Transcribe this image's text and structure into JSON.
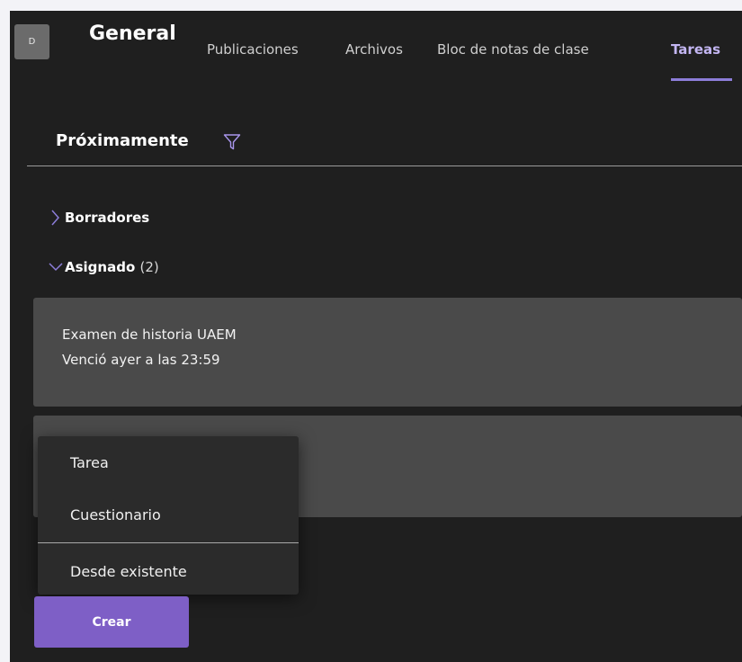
{
  "header": {
    "avatar_initial": "D",
    "team_name": "General",
    "tabs": [
      {
        "label": "Publicaciones"
      },
      {
        "label": "Archivos"
      },
      {
        "label": "Bloc de notas de clase"
      },
      {
        "label": "Tareas",
        "active": true
      }
    ]
  },
  "section": {
    "title": "Próximamente",
    "filter_icon": "filter-icon"
  },
  "groups": [
    {
      "label": "Borradores",
      "expanded": false
    },
    {
      "label": "Asignado",
      "count": "(2)",
      "expanded": true
    }
  ],
  "assignments": [
    {
      "title": "Examen de historia UAEM",
      "due": "Venció ayer a las 23:59"
    }
  ],
  "create_menu": {
    "items": [
      {
        "label": "Tarea"
      },
      {
        "label": "Cuestionario"
      },
      {
        "label": "Desde existente"
      }
    ]
  },
  "create_button": {
    "label": "Crear"
  },
  "colors": {
    "accent": "#8c7dd9",
    "button": "#7e5fc6",
    "background": "#1f1f1f",
    "card": "#4a4a4a",
    "menu": "#2b2b2b"
  }
}
